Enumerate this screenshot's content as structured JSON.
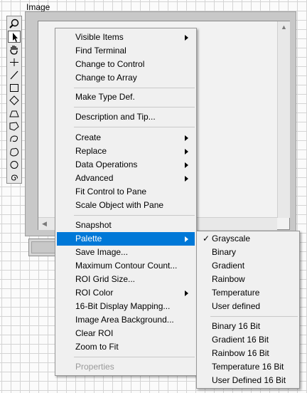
{
  "title": "Image",
  "toolbar": {
    "tools": [
      "zoom-icon",
      "pointer-icon",
      "pan-icon",
      "crosshair-icon",
      "line-icon",
      "rectangle-icon",
      "rotated-rectangle-icon",
      "annulus-icon",
      "polygon-icon",
      "freehand-icon",
      "freehand-region-icon",
      "oval-icon",
      "spiral-icon"
    ],
    "selected": "pointer-icon"
  },
  "context_menu": {
    "items": [
      {
        "label": "Visible Items",
        "submenu": true
      },
      {
        "label": "Find Terminal"
      },
      {
        "label": "Change to Control"
      },
      {
        "label": "Change to Array"
      },
      {
        "label": "Make Type Def."
      },
      {
        "label": "Description and Tip..."
      },
      {
        "label": "Create",
        "submenu": true
      },
      {
        "label": "Replace",
        "submenu": true
      },
      {
        "label": "Data Operations",
        "submenu": true
      },
      {
        "label": "Advanced",
        "submenu": true
      },
      {
        "label": "Fit Control to Pane"
      },
      {
        "label": "Scale Object with Pane"
      },
      {
        "label": "Snapshot"
      },
      {
        "label": "Palette",
        "submenu": true,
        "highlighted": true
      },
      {
        "label": "Save Image..."
      },
      {
        "label": "Maximum Contour Count..."
      },
      {
        "label": "ROI Grid Size..."
      },
      {
        "label": "ROI Color",
        "submenu": true
      },
      {
        "label": "16-Bit Display Mapping..."
      },
      {
        "label": "Image Area Background..."
      },
      {
        "label": "Clear ROI"
      },
      {
        "label": "Zoom to Fit"
      },
      {
        "label": "Properties",
        "disabled": true
      }
    ]
  },
  "palette_menu": {
    "items": [
      {
        "label": "Grayscale",
        "checked": true
      },
      {
        "label": "Binary"
      },
      {
        "label": "Gradient"
      },
      {
        "label": "Rainbow"
      },
      {
        "label": "Temperature"
      },
      {
        "label": "User defined"
      },
      {
        "label": "Binary 16 Bit"
      },
      {
        "label": "Gradient 16 Bit"
      },
      {
        "label": "Rainbow 16 Bit"
      },
      {
        "label": "Temperature 16 Bit"
      },
      {
        "label": "User Defined 16 Bit"
      }
    ],
    "check_mark": "✓"
  },
  "colors": {
    "highlight": "#0078d7",
    "menu_bg": "#f0f0f0"
  }
}
